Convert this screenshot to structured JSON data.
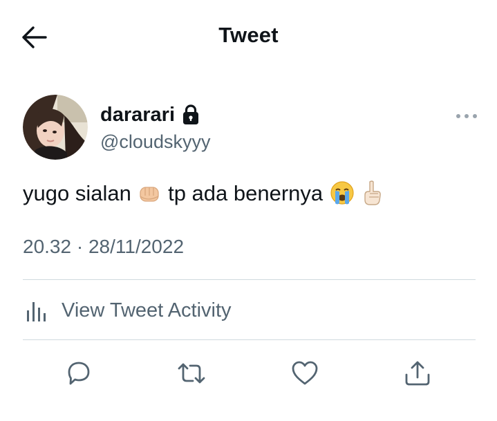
{
  "header": {
    "title": "Tweet"
  },
  "author": {
    "display_name": "dararari",
    "handle": "@cloudskyyy",
    "protected": true
  },
  "tweet": {
    "text_part1": "yugo sialan",
    "text_part2": "tp ada benernya",
    "emojis": [
      "fist-emoji",
      "crying-face-emoji",
      "index-pointing-up-emoji"
    ],
    "time": "20.32",
    "separator": "·",
    "date": "28/11/2022"
  },
  "activity": {
    "label": "View Tweet Activity"
  },
  "actions": [
    "reply",
    "retweet",
    "like",
    "share"
  ],
  "colors": {
    "text_primary": "#0f1419",
    "text_secondary": "#536471",
    "divider": "#cfd9de",
    "background": "#ffffff"
  }
}
